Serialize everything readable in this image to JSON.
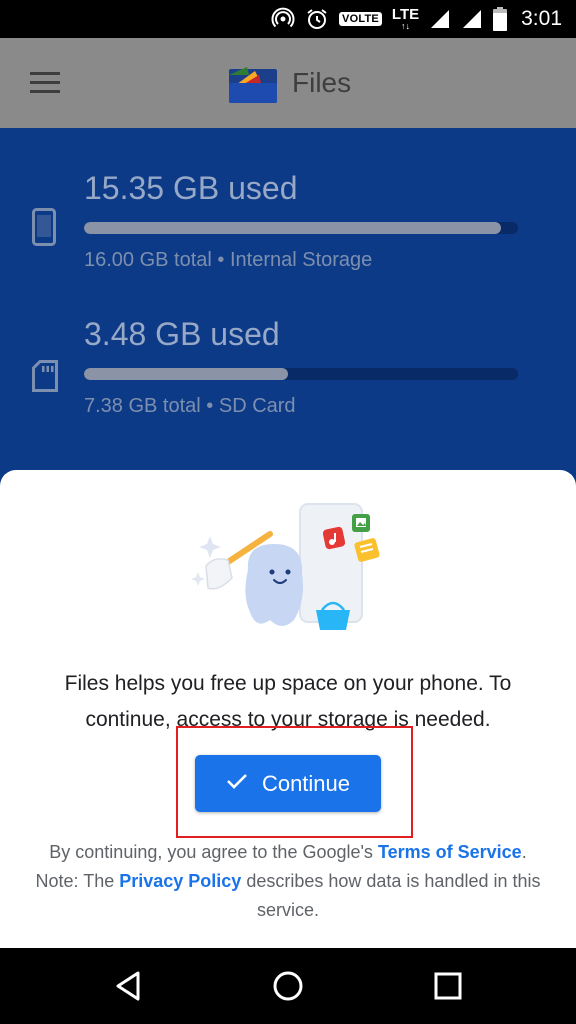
{
  "status_bar": {
    "volte": "VOLTE",
    "lte": "LTE",
    "lte_arrows": "↑↓",
    "time": "3:01"
  },
  "app_bar": {
    "title": "Files",
    "menu_icon": "hamburger-menu-icon",
    "logo_icon": "files-logo-icon"
  },
  "storage": {
    "internal": {
      "used": "15.35 GB used",
      "total": "16.00 GB total • Internal Storage",
      "fill_percent": 96,
      "icon": "phone-icon"
    },
    "sd": {
      "used": "3.48 GB used",
      "total": "7.38 GB total • SD Card",
      "fill_percent": 47,
      "icon": "sd-card-icon"
    }
  },
  "sheet": {
    "message": "Files helps you free up space on your phone. To continue, access to your storage is needed.",
    "continue_label": "Continue",
    "legal_prefix": "By continuing, you agree to the Google's ",
    "terms_link": "Terms of Service",
    "legal_middle": ". Note: The ",
    "privacy_link": "Privacy Policy",
    "legal_suffix": " describes how data is handled in this service."
  },
  "colors": {
    "accent": "#1a73e8",
    "storage_bg": "#0d3a87",
    "highlight": "#e02020"
  }
}
